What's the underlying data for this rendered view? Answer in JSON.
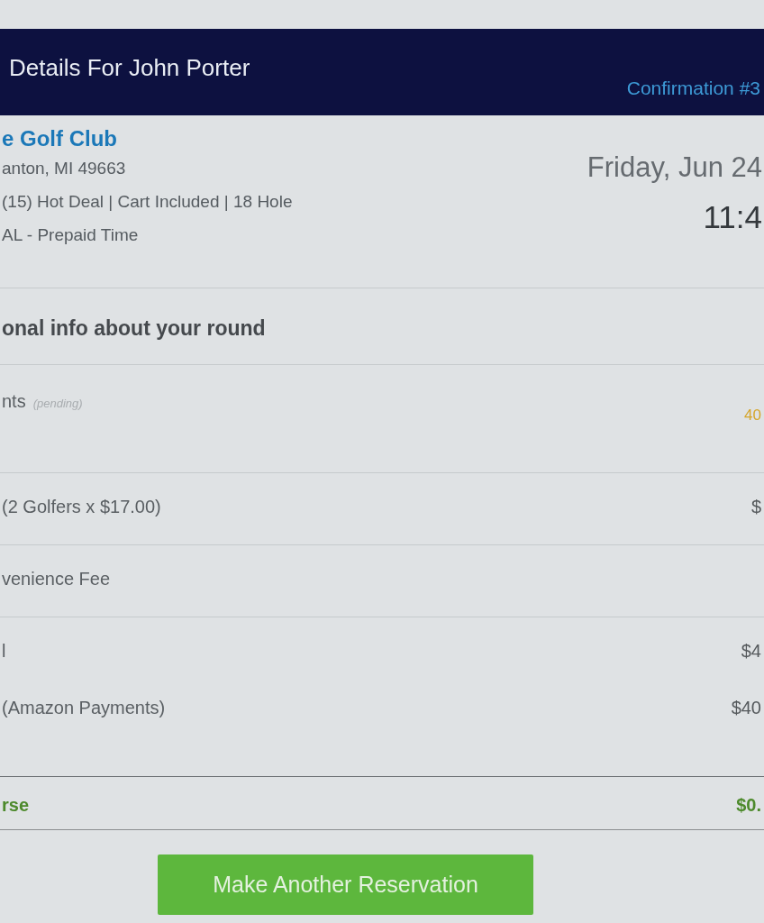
{
  "header": {
    "title": "Details For John Porter",
    "confirmation": "Confirmation #3"
  },
  "course": {
    "name": "e Golf Club",
    "lines": [
      "anton, MI 49663",
      "(15) Hot Deal | Cart Included | 18 Hole",
      "AL - Prepaid Time"
    ],
    "date": "Friday, Jun 24",
    "time": "11:4"
  },
  "section_heading": "onal info about your round",
  "groups": [
    {
      "kind": "points",
      "rows": [
        {
          "label": "nts",
          "note": "(pending)",
          "value": "40"
        }
      ]
    },
    {
      "kind": "charge",
      "rows": [
        {
          "label": "(2 Golfers x $17.00)",
          "value": "$"
        }
      ]
    },
    {
      "kind": "charge",
      "rows": [
        {
          "label": "venience Fee"
        }
      ]
    },
    {
      "kind": "charge",
      "rows": [
        {
          "label": "l",
          "value": "$4"
        },
        {
          "label": "(Amazon Payments)",
          "value": "$40"
        }
      ]
    },
    {
      "kind": "balance",
      "rows": [
        {
          "label": "rse",
          "value": "$0."
        }
      ]
    }
  ],
  "button": "Make Another Reservation"
}
